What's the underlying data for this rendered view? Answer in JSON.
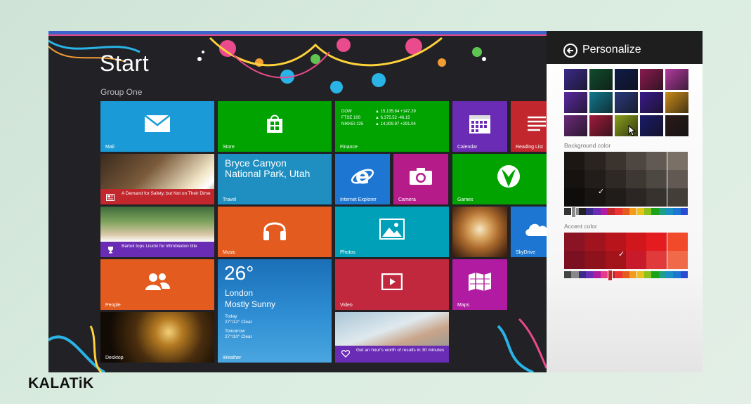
{
  "start": {
    "title": "Start",
    "group": "Group One"
  },
  "tiles": {
    "mail": "Mail",
    "store": "Store",
    "finance": {
      "label": "Finance",
      "rows": [
        {
          "name": "DOW",
          "value": "▲ 15,135.84 +147.29"
        },
        {
          "name": "FTSE 100",
          "value": "▲ 6,375.52 -46.15"
        },
        {
          "name": "NIKKEI 225",
          "value": "▲ 14,309.97 +291.04"
        }
      ]
    },
    "calendar": "Calendar",
    "reading_list": "Reading List",
    "news": "A Demand for Safety, but Not on Their Dime",
    "travel": {
      "title": "Bryce Canyon National Park, Utah",
      "label": "Travel"
    },
    "internet_explorer": "Internet Explorer",
    "camera": "Camera",
    "games": "Games",
    "sports": "Bartoli tops Lisicki for Wimbledon title",
    "music": "Music",
    "photos": "Photos",
    "skydrive": "SkyDrive",
    "people": "People",
    "weather": {
      "temp": "26°",
      "city": "London",
      "condition": "Mostly Sunny",
      "today_label": "Today",
      "today_value": "27°/12° Clear",
      "tomorrow_label": "Tomorrow",
      "tomorrow_value": "27°/10° Clear",
      "label": "Weather"
    },
    "video": "Video",
    "maps": "Maps",
    "desktop": "Desktop",
    "health": "Get an hour's worth of results in 30 minutes"
  },
  "personalize": {
    "title": "Personalize",
    "background_color_label": "Background color",
    "accent_color_label": "Accent color"
  },
  "colors": {
    "mail": "#1a9bd7",
    "store": "#00a300",
    "finance": "#00a300",
    "calendar": "#6a2bb5",
    "reading_list": "#c1272d",
    "travel": "#1f8fc1",
    "internet_explorer": "#1d77d2",
    "camera": "#b51c8a",
    "games": "#00a300",
    "music": "#e35b1e",
    "photos": "#00a0b8",
    "skydrive": "#1d77d2",
    "people": "#e35b1e",
    "video": "#c1273d",
    "maps": "#b11ba1",
    "news_caption": "#c1272d",
    "sports_caption": "#6a2bb5",
    "health_caption": "#6a2bb5"
  },
  "brand": {
    "name": "KALATiK"
  }
}
